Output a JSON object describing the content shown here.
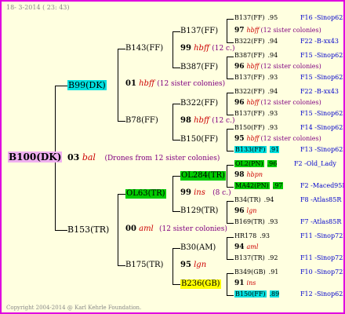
{
  "date": "18- 3-2014 ( 23: 43)",
  "copyright": "Copyright 2004-2014 @ Karl Kehrle Foundation.",
  "colors": {
    "border": "#e000e0",
    "background": "#ffffe0",
    "root_bg": "#f0b0f0",
    "cyan_bg": "#00e0e0",
    "green_bg": "#00cc00",
    "yellow_bg": "#ffff00"
  },
  "tree": {
    "root": "B100(DK)",
    "g1_up": "B99(DK)",
    "g1_mid": {
      "num": "03",
      "name": "bal",
      "note": "(Drones from 12 sister colonies)"
    },
    "g1_down": "B153(TR)",
    "g2_a": "B143(FF)",
    "g2_a_mid": {
      "num": "01",
      "name": "hbff",
      "note": "(12 sister colonies)"
    },
    "g2_b": "B78(FF)",
    "g2_c": "OL63(TR)",
    "g2_c_mid": {
      "num": "00",
      "name": "aml",
      "note": "(12 sister colonies)"
    },
    "g2_d": "B175(TR)",
    "g3": [
      {
        "name": "B137(FF)"
      },
      {
        "num": "99",
        "name": "hbff",
        "note": "(12 c.)"
      },
      {
        "name": "B387(FF)"
      },
      {
        "name": "B322(FF)"
      },
      {
        "num": "98",
        "name": "hbff",
        "note": "(12 c.)"
      },
      {
        "name": "B150(FF)"
      },
      {
        "name": "OL284(TR)"
      },
      {
        "num": "99",
        "name": "ins",
        "note": "(8 c.)"
      },
      {
        "name": "B129(TR)"
      },
      {
        "name": "B30(AM)"
      },
      {
        "num": "95",
        "name": "lgn"
      },
      {
        "name": "B236(GB)"
      }
    ],
    "g4": [
      {
        "name": "B137(FF)",
        "score": ".95",
        "ref": "F16 -Sinop62R"
      },
      {
        "num": "97",
        "name": "hbff",
        "note": "(12 sister colonies)"
      },
      {
        "name": "B322(FF)",
        "score": ".94",
        "ref": "F22 -B-xx43"
      },
      {
        "name": "B387(FF)",
        "score": ".94",
        "ref": "F15 -Sinop62R"
      },
      {
        "num": "96",
        "name": "hbff",
        "note": "(12 sister colonies)"
      },
      {
        "name": "B137(FF)",
        "score": ".93",
        "ref": "F15 -Sinop62R"
      },
      {
        "name": "B322(FF)",
        "score": ".94",
        "ref": "F22 -B-xx43"
      },
      {
        "num": "96",
        "name": "hbff",
        "note": "(12 sister colonies)"
      },
      {
        "name": "B137(FF)",
        "score": ".93",
        "ref": "F15 -Sinop62R"
      },
      {
        "name": "B150(FF)",
        "score": ".93",
        "ref": "F14 -Sinop62R"
      },
      {
        "num": "95",
        "name": "hbff",
        "note": "(12 sister colonies)"
      },
      {
        "name": "B133(FF)",
        "score": ".91",
        "ref": "F13 -Sinop62R"
      },
      {
        "name": "OL2(PN)",
        "score": ".96",
        "ref": "F2 -Old_Lady"
      },
      {
        "num": "98",
        "name": "hbpn"
      },
      {
        "name": "MA42(PN)",
        "score": ".97",
        "ref": "F2 -Maced95R"
      },
      {
        "name": "B34(TR)",
        "score": ".94",
        "ref": "F8 -Atlas85R"
      },
      {
        "num": "96",
        "name": "lgn"
      },
      {
        "name": "B169(TR)",
        "score": ".93",
        "ref": "F7 -Atlas85R"
      },
      {
        "name": "HR178",
        "score": ".93",
        "ref": "F11 -Sinop72R"
      },
      {
        "num": "94",
        "name": "aml"
      },
      {
        "name": "B137(TR)",
        "score": ".92",
        "ref": "F11 -Sinop72R"
      },
      {
        "name": "B349(GB)",
        "score": ".91",
        "ref": "F10 -Sinop72R"
      },
      {
        "num": "91",
        "name": "ins"
      },
      {
        "name": "B150(FF)",
        "score": ".89",
        "ref": "F12 -Sinop62R"
      }
    ]
  }
}
